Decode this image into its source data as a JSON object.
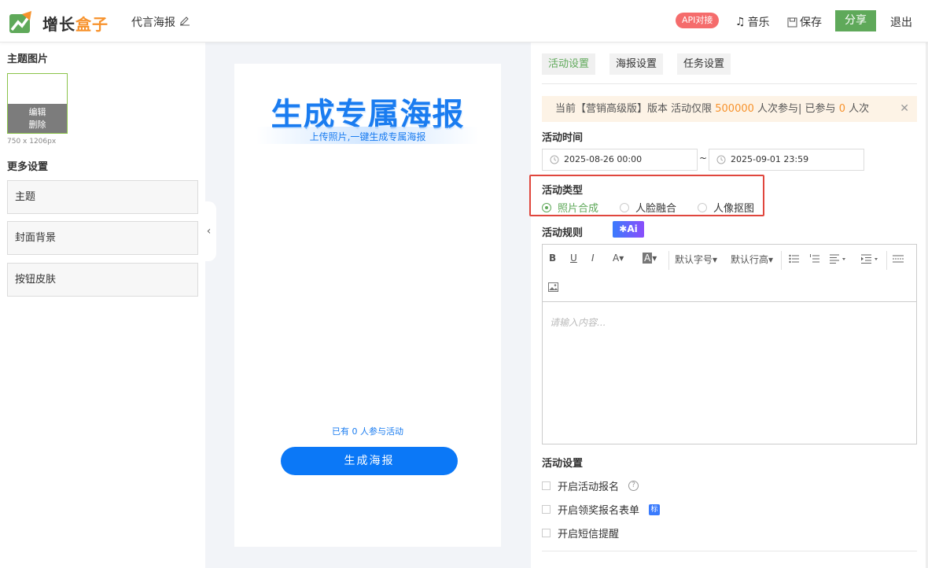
{
  "header": {
    "brand_part1": "增长",
    "brand_part2": "盒子",
    "doc_title": "代言海报",
    "api_badge": "API对接",
    "music_label": "音乐",
    "save_label": "保存",
    "share_label": "分享",
    "exit_label": "退出"
  },
  "left": {
    "theme_image_title": "主题图片",
    "edit_label": "编辑",
    "delete_label": "删除",
    "image_size": "750 x 1206px",
    "more_settings_title": "更多设置",
    "items": [
      {
        "label": "主题"
      },
      {
        "label": "封面背景"
      },
      {
        "label": "按钮皮肤"
      }
    ]
  },
  "preview": {
    "title": "生成专属海报",
    "subtitle": "上传照片,一键生成专属海报",
    "participants": "已有 0 人参与活动",
    "button": "生成海报"
  },
  "right": {
    "tabs": [
      {
        "label": "活动设置",
        "active": true
      },
      {
        "label": "海报设置",
        "active": false
      },
      {
        "label": "任务设置",
        "active": false
      }
    ],
    "notice": {
      "prefix": "当前【营销高级版】版本 活动仅限 ",
      "limit": "500000",
      "mid": " 人次参与| 已参与 ",
      "count": "0",
      "suffix": " 人次"
    },
    "activity_time_label": "活动时间",
    "start_time": "2025-08-26 00:00",
    "end_time": "2025-09-01 23:59",
    "range_sep": "~",
    "activity_type_label": "活动类型",
    "activity_types": [
      {
        "label": "照片合成",
        "selected": true
      },
      {
        "label": "人脸融合",
        "selected": false
      },
      {
        "label": "人像抠图",
        "selected": false
      }
    ],
    "activity_rules_label": "活动规则",
    "ai_badge": "✱Ai",
    "toolbar": {
      "bold": "B",
      "underline": "U",
      "italic": "I",
      "font_color": "A",
      "bg_color": "A",
      "font_size": "默认字号",
      "line_height": "默认行高"
    },
    "editor_placeholder": "请输入内容...",
    "activity_settings_label": "活动设置",
    "checks": [
      {
        "label": "开启活动报名"
      },
      {
        "label": "开启领奖报名表单"
      },
      {
        "label": "开启短信提醒"
      }
    ],
    "mark_label": "标",
    "help_label": "?"
  },
  "colors": {
    "accent_green": "#5fa95a",
    "brand_orange": "#f7922c",
    "poster_blue": "#1a7cf0",
    "highlight_red": "#e0463d"
  }
}
